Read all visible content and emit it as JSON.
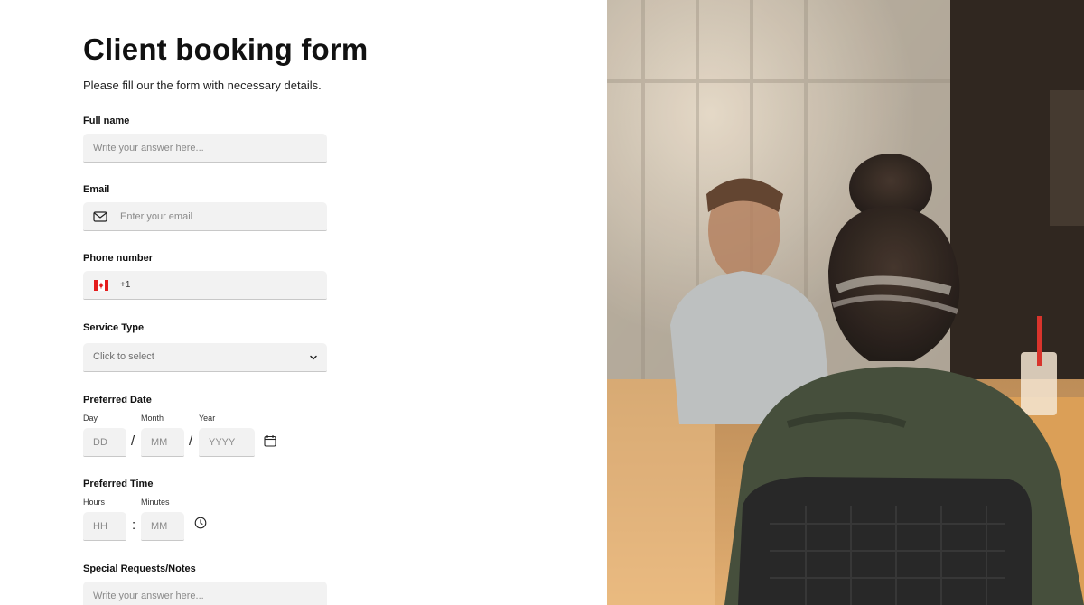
{
  "form": {
    "title": "Client booking form",
    "subtitle": "Please fill our the form with necessary details.",
    "full_name": {
      "label": "Full name",
      "placeholder": "Write your answer here..."
    },
    "email": {
      "label": "Email",
      "placeholder": "Enter your email",
      "icon": "mail-icon"
    },
    "phone": {
      "label": "Phone number",
      "country_code": "+1",
      "flag": "canada-flag-icon"
    },
    "service_type": {
      "label": "Service Type",
      "placeholder": "Click to select",
      "icon": "chevron-down-icon"
    },
    "preferred_date": {
      "label": "Preferred Date",
      "day_label": "Day",
      "month_label": "Month",
      "year_label": "Year",
      "day_placeholder": "DD",
      "month_placeholder": "MM",
      "year_placeholder": "YYYY",
      "separator": "/",
      "icon": "calendar-icon"
    },
    "preferred_time": {
      "label": "Preferred Time",
      "hours_label": "Hours",
      "minutes_label": "Minutes",
      "hours_placeholder": "HH",
      "minutes_placeholder": "MM",
      "separator": ":",
      "icon": "clock-icon"
    },
    "special_requests": {
      "label": "Special Requests/Notes",
      "placeholder": "Write your answer here..."
    }
  },
  "colors": {
    "input_bg": "#f2f2f2",
    "input_border": "#c8c8c8",
    "text": "#111111",
    "placeholder": "#8a8a8a"
  }
}
